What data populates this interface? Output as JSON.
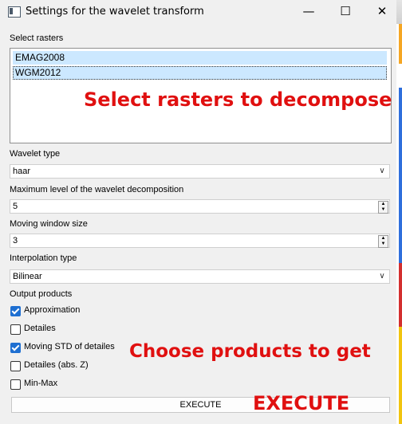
{
  "window": {
    "title": "Settings for the wavelet transform",
    "controls": {
      "minimize": "—",
      "maximize": "☐",
      "close": "✕"
    }
  },
  "rasters": {
    "label": "Select rasters",
    "items": [
      "EMAG2008",
      "WGM2012"
    ]
  },
  "wavelet_type": {
    "label": "Wavelet type",
    "value": "haar"
  },
  "max_level": {
    "label": "Maximum level of the wavelet decomposition",
    "value": "5"
  },
  "window_size": {
    "label": "Moving window size",
    "value": "3"
  },
  "interpolation": {
    "label": "Interpolation type",
    "value": "Bilinear"
  },
  "outputs": {
    "label": "Output products",
    "items": [
      {
        "label": "Approximation",
        "checked": true
      },
      {
        "label": "Detailes",
        "checked": false
      },
      {
        "label": "Moving STD of detailes",
        "checked": true
      },
      {
        "label": "Detailes (abs. Z)",
        "checked": false
      },
      {
        "label": "Min-Max",
        "checked": false
      }
    ]
  },
  "execute_label": "EXECUTE",
  "annotations": {
    "rasters": "Select rasters to decompose",
    "products": "Choose products to get",
    "execute": "EXECUTE"
  },
  "colors": {
    "annotation": "#e01010",
    "selection": "#cce8ff",
    "check": "#1e6fd1"
  }
}
